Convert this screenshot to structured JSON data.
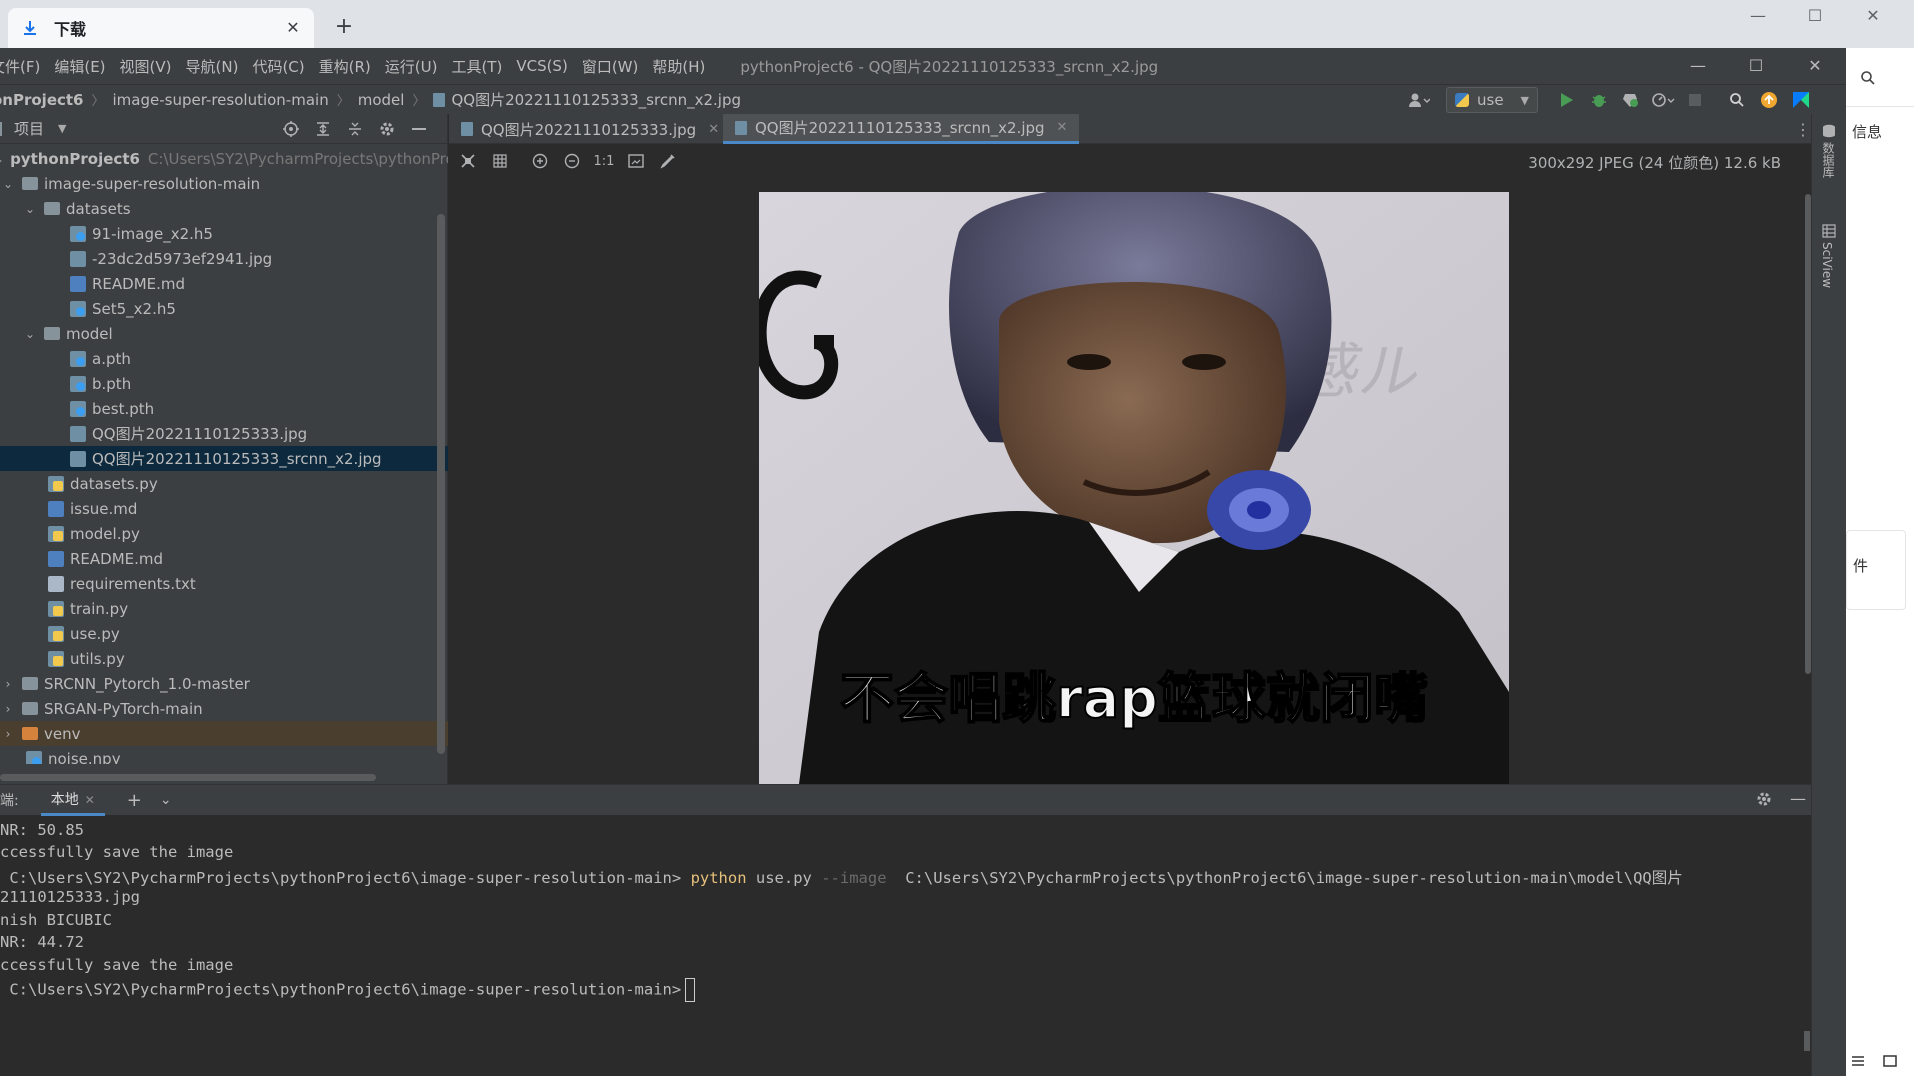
{
  "browser": {
    "tab_label": "下载",
    "new_tab": "+",
    "side_panel_1": "信息",
    "side_panel_2": "件"
  },
  "ide": {
    "menu": [
      "文件(F)",
      "编辑(E)",
      "视图(V)",
      "导航(N)",
      "代码(C)",
      "重构(R)",
      "运行(U)",
      "工具(T)",
      "VCS(S)",
      "窗口(W)",
      "帮助(H)"
    ],
    "window_title": "pythonProject6 - QQ图片20221110125333_srcnn_x2.jpg",
    "breadcrumb": [
      "onProject6",
      "image-super-resolution-main",
      "model",
      "QQ图片20221110125333_srcnn_x2.jpg"
    ],
    "run_config": "use",
    "project_panel": {
      "label": "项目",
      "root_name": "pythonProject6",
      "root_path": "C:\\Users\\SY2\\PycharmProjects\\pythonPro",
      "items": [
        "image-super-resolution-main",
        "datasets",
        "91-image_x2.h5",
        "-23dc2d5973ef2941.jpg",
        "README.md",
        "Set5_x2.h5",
        "model",
        "a.pth",
        "b.pth",
        "best.pth",
        "QQ图片20221110125333.jpg",
        "QQ图片20221110125333_srcnn_x2.jpg",
        "datasets.py",
        "issue.md",
        "model.py",
        "README.md",
        "requirements.txt",
        "train.py",
        "use.py",
        "utils.py",
        "SRCNN_Pytorch_1.0-master",
        "SRGAN-PyTorch-main",
        "venv",
        "noise.npy"
      ]
    },
    "editor": {
      "tabs": [
        "QQ图片20221110125333.jpg",
        "QQ图片20221110125333_srcnn_x2.jpg"
      ],
      "image_info": "300x292 JPEG (24 位颜色) 12.6 kB",
      "zoom_actual": "1:1",
      "image_caption": "不会唱跳rap篮球就闭嘴"
    },
    "right_strip": [
      "数据库",
      "SciView"
    ],
    "terminal": {
      "label": "端:",
      "tab": "本地",
      "lines": {
        "l1": "NR: 50.85",
        "l2": "ccessfully save the image",
        "l3_prompt": " C:\\Users\\SY2\\PycharmProjects\\pythonProject6\\image-super-resolution-main> ",
        "l3_cmd": "python",
        "l3_script": " use.py ",
        "l3_opt": "--image",
        "l3_arg": "  C:\\Users\\SY2\\PycharmProjects\\pythonProject6\\image-super-resolution-main\\model\\QQ图片",
        "l4": "21110125333.jpg",
        "l5": "nish BICUBIC",
        "l6": "NR: 44.72",
        "l7": "ccessfully save the image",
        "l8_prompt": " C:\\Users\\SY2\\PycharmProjects\\pythonProject6\\image-super-resolution-main>"
      }
    }
  },
  "colors": {
    "accent": "#4a88c7",
    "ide_bg": "#2b2b2b",
    "panel_bg": "#3c3f41",
    "selected_row": "#0d293e"
  }
}
